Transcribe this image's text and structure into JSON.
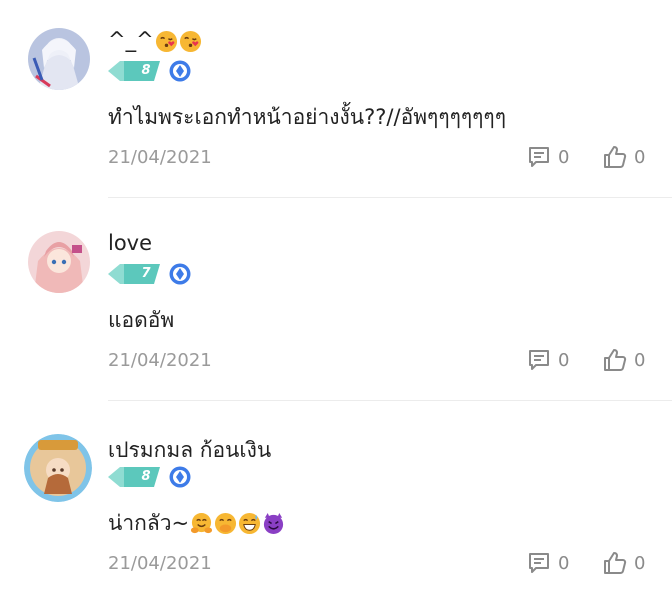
{
  "comments": [
    {
      "username": "^_^",
      "username_emojis": [
        "kissing-heart-emoji",
        "kissing-heart-emoji"
      ],
      "level": "8",
      "text": "ทำไมพระเอกทำหน้าอย่างงั้น??//อัพๆๆๆๆๆๆๆ",
      "text_emojis": [],
      "date": "21/04/2021",
      "reply_count": "0",
      "like_count": "0"
    },
    {
      "username": "love",
      "username_emojis": [],
      "level": "7",
      "text": "แอดอัพ",
      "text_emojis": [],
      "date": "21/04/2021",
      "reply_count": "0",
      "like_count": "0"
    },
    {
      "username": "เปรมกมล ก้อนเงิน",
      "username_emojis": [],
      "level": "8",
      "text": "น่ากลัว~",
      "text_emojis": [
        "hugging-emoji",
        "hand-over-mouth-emoji",
        "grinning-sweat-emoji",
        "smiling-devil-emoji"
      ],
      "date": "21/04/2021",
      "reply_count": "0",
      "like_count": "0"
    }
  ],
  "colors": {
    "level_badge": "#5cc8bc",
    "vip_icon": "#3d7be8",
    "text": "#222222",
    "muted": "#9a9a9a"
  }
}
